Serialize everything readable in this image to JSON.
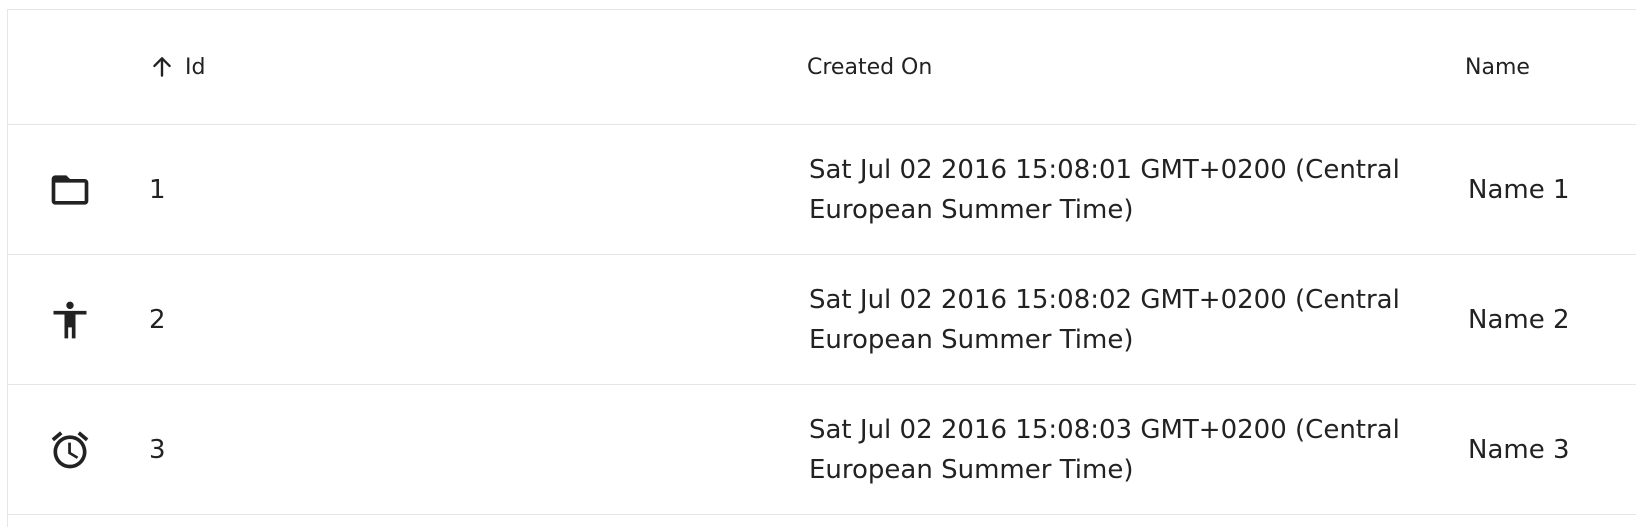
{
  "table": {
    "headers": {
      "id": "Id",
      "created_on": "Created On",
      "name": "Name"
    },
    "sort": {
      "column": "id",
      "direction": "ascending",
      "icon": "arrow-up-icon"
    },
    "rows": [
      {
        "icon": "folder-icon",
        "id": "1",
        "created_on": "Sat Jul 02 2016 15:08:01 GMT+0200 (Central European Summer Time)",
        "name": "Name 1"
      },
      {
        "icon": "accessibility-icon",
        "id": "2",
        "created_on": "Sat Jul 02 2016 15:08:02 GMT+0200 (Central European Summer Time)",
        "name": "Name 2"
      },
      {
        "icon": "alarm-icon",
        "id": "3",
        "created_on": "Sat Jul 02 2016 15:08:03 GMT+0200 (Central European Summer Time)",
        "name": "Name 3"
      }
    ]
  }
}
